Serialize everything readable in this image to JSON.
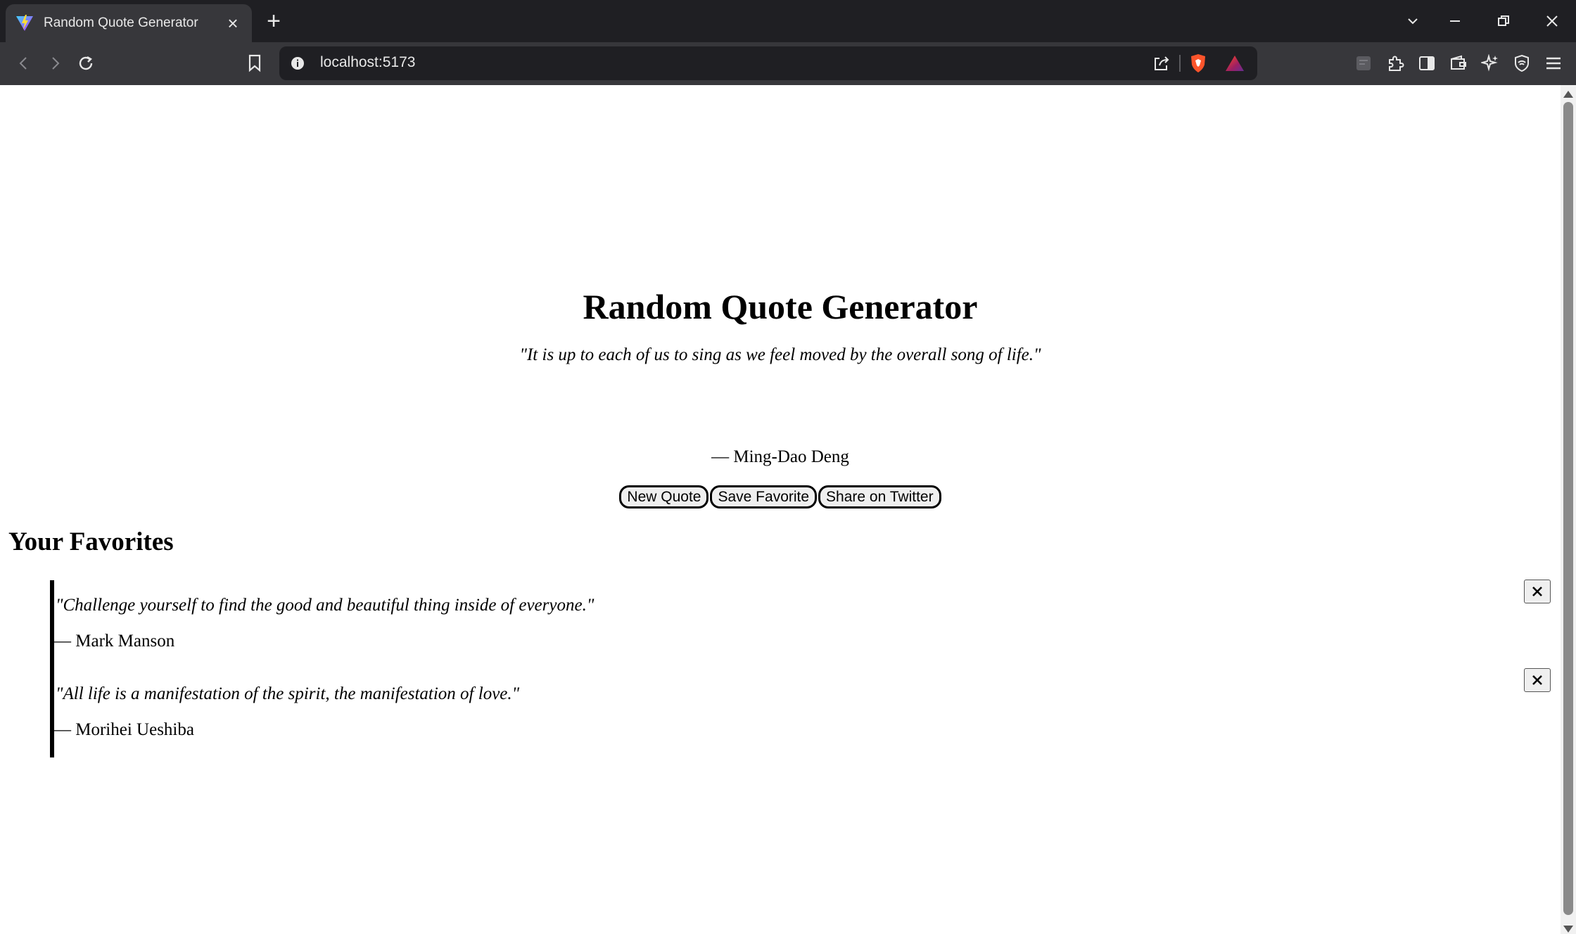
{
  "browser": {
    "tab_title": "Random Quote Generator",
    "new_tab_label": "+",
    "url": "localhost:5173"
  },
  "page": {
    "title": "Random Quote Generator",
    "current_quote": "\"It is up to each of us to sing as we feel moved by the overall song of life.\"",
    "current_author": "— Ming-Dao Deng",
    "buttons": {
      "new_quote": "New Quote",
      "save_favorite": "Save Favorite",
      "share": "Share on Twitter"
    },
    "favorites_heading": "Your Favorites",
    "favorites": [
      {
        "quote": "\"Challenge yourself to find the good and beautiful thing inside of everyone.\"",
        "author": "— Mark Manson"
      },
      {
        "quote": "\"All life is a manifestation of the spirit, the manifestation of love.\"",
        "author": "— Morihei Ueshiba"
      }
    ]
  },
  "icons": [
    "vite-favicon",
    "close-icon",
    "plus-icon",
    "chevron-down-icon",
    "minimize-icon",
    "restore-icon",
    "back-icon",
    "forward-icon",
    "reload-icon",
    "bookmark-icon",
    "info-icon",
    "share-icon",
    "brave-shield-icon",
    "brave-rewards-icon",
    "extensions-icon",
    "sidebar-icon",
    "wallet-icon",
    "leo-icon",
    "vpn-icon",
    "menu-icon"
  ],
  "colors": {
    "chrome_dark": "#1f1f23",
    "chrome_toolbar": "#37373b",
    "page_bg": "#ffffff",
    "text": "#000000"
  }
}
